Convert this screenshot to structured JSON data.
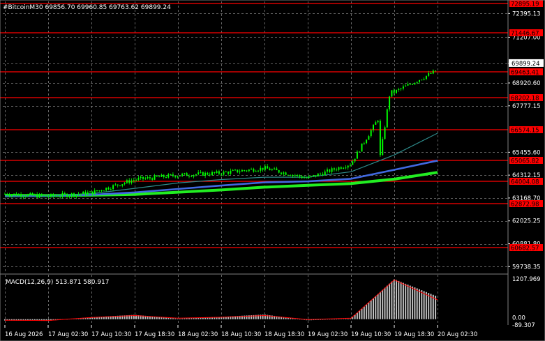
{
  "header": {
    "title": "#BitcoinM30  69856.70 69960.85 69763.62 69899.24"
  },
  "colors": {
    "background": "#000000",
    "grid": "#7f7f7f",
    "axis_text": "#ffffff",
    "candles": "#00ff00",
    "level_line": "#ff0000",
    "level_label_bg": "#ff0000",
    "current_price_bg": "#ffffff",
    "ma_fast": "#2e8b8b",
    "ma_mid": "#4169e1",
    "ma_slow": "#22ee22",
    "macd_hist": "#c0c0c0",
    "macd_signal": "#ff0000"
  },
  "price_axis": {
    "labels": [
      "72395.13",
      "71207.00",
      "69899.24",
      "68920.60",
      "67777.15",
      "65455.60",
      "64312.15",
      "63168.70",
      "62025.25",
      "60881.80",
      "59738.35"
    ],
    "current_price": "69899.24"
  },
  "levels": [
    "72895.19",
    "71446.67",
    "69463.41",
    "68202.18",
    "66574.15",
    "65065.82",
    "64004.08",
    "62872.98",
    "60682.57"
  ],
  "time_axis": {
    "labels": [
      "16 Aug 2026",
      "17 Aug 02:30",
      "17 Aug 10:30",
      "17 Aug 18:30",
      "18 Aug 02:30",
      "18 Aug 10:30",
      "18 Aug 18:30",
      "19 Aug 02:30",
      "19 Aug 10:30",
      "19 Aug 18:30",
      "20 Aug 02:30"
    ]
  },
  "macd": {
    "title": "MACD(12,26,9) 513.871 580.917",
    "axis_labels": [
      "1207.969",
      "0.00",
      "-89.307"
    ]
  },
  "chart_data": {
    "type": "line",
    "symbol": "#BitcoinM30",
    "ohlc_last": {
      "open": 69856.7,
      "high": 69960.85,
      "low": 69763.62,
      "close": 69899.24
    },
    "ylim": [
      59400,
      73000
    ],
    "x": [
      "16 Aug 2026",
      "17 Aug 02:30",
      "17 Aug 10:30",
      "17 Aug 18:30",
      "18 Aug 02:30",
      "18 Aug 10:30",
      "18 Aug 18:30",
      "19 Aug 02:30",
      "19 Aug 10:30",
      "19 Aug 18:30",
      "20 Aug 02:30"
    ],
    "series": [
      {
        "values": [
          63380,
          63250,
          63430,
          64090,
          64310,
          64420,
          64660,
          64160,
          64890,
          68460,
          69560
        ]
      },
      {
        "values": [
          63240,
          63290,
          63390,
          63650,
          63920,
          64090,
          64210,
          64210,
          64480,
          65320,
          66410
        ]
      },
      {
        "values": [
          63250,
          63270,
          63330,
          63450,
          63620,
          63790,
          63950,
          64000,
          64130,
          64580,
          65040
        ]
      },
      {
        "values": [
          63300,
          63290,
          63310,
          63350,
          63460,
          63570,
          63710,
          63800,
          63890,
          64110,
          64450
        ]
      }
    ],
    "macd": {
      "ylim": [
        -89.307,
        1207.969
      ],
      "histogram": [
        -40,
        -50,
        60,
        130,
        15,
        70,
        140,
        -35,
        20,
        1200,
        680
      ],
      "signal": [
        -30,
        -40,
        50,
        110,
        30,
        60,
        110,
        -10,
        30,
        1180,
        580
      ]
    }
  }
}
